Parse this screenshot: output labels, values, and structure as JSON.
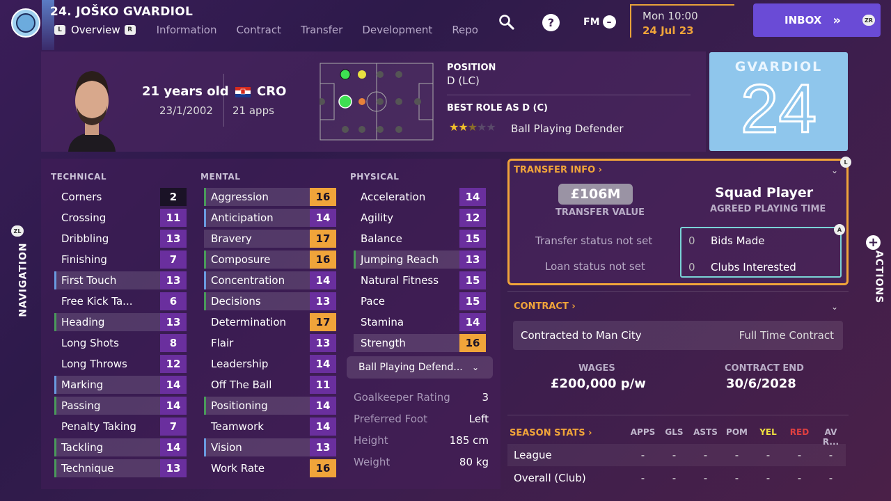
{
  "header": {
    "player_title": "24. JOŠKO GVARDIOL",
    "tabs": [
      "Overview",
      "Information",
      "Contract",
      "Transfer",
      "Development",
      "Repo"
    ],
    "tab_key_left": "L",
    "tab_key_right": "R",
    "fm_label": "FM",
    "date_time": "Mon 10:00",
    "date": "24 Jul 23",
    "inbox_label": "INBOX",
    "inbox_key": "ZR"
  },
  "profile": {
    "age": "21 years old",
    "dob": "23/1/2002",
    "nation": "CRO",
    "apps": "21 apps",
    "position_label": "POSITION",
    "position_value": "D (LC)",
    "best_role_label": "BEST ROLE AS D (C)",
    "best_role_value": "Ball Playing Defender",
    "role_stars": 2.5,
    "shirt_name": "GVARDIOL",
    "shirt_number": "24"
  },
  "attributes": {
    "technical_title": "TECHNICAL",
    "mental_title": "MENTAL",
    "physical_title": "PHYSICAL",
    "technical": [
      {
        "name": "Corners",
        "value": "2"
      },
      {
        "name": "Crossing",
        "value": "11"
      },
      {
        "name": "Dribbling",
        "value": "13"
      },
      {
        "name": "Finishing",
        "value": "7"
      },
      {
        "name": "First Touch",
        "value": "13"
      },
      {
        "name": "Free Kick Ta...",
        "value": "6"
      },
      {
        "name": "Heading",
        "value": "13"
      },
      {
        "name": "Long Shots",
        "value": "8"
      },
      {
        "name": "Long Throws",
        "value": "12"
      },
      {
        "name": "Marking",
        "value": "14"
      },
      {
        "name": "Passing",
        "value": "14"
      },
      {
        "name": "Penalty Taking",
        "value": "7"
      },
      {
        "name": "Tackling",
        "value": "14"
      },
      {
        "name": "Technique",
        "value": "13"
      }
    ],
    "mental": [
      {
        "name": "Aggression",
        "value": "16"
      },
      {
        "name": "Anticipation",
        "value": "14"
      },
      {
        "name": "Bravery",
        "value": "17"
      },
      {
        "name": "Composure",
        "value": "16"
      },
      {
        "name": "Concentration",
        "value": "14"
      },
      {
        "name": "Decisions",
        "value": "13"
      },
      {
        "name": "Determination",
        "value": "17"
      },
      {
        "name": "Flair",
        "value": "13"
      },
      {
        "name": "Leadership",
        "value": "14"
      },
      {
        "name": "Off The Ball",
        "value": "11"
      },
      {
        "name": "Positioning",
        "value": "14"
      },
      {
        "name": "Teamwork",
        "value": "14"
      },
      {
        "name": "Vision",
        "value": "13"
      },
      {
        "name": "Work Rate",
        "value": "16"
      }
    ],
    "physical": [
      {
        "name": "Acceleration",
        "value": "14"
      },
      {
        "name": "Agility",
        "value": "12"
      },
      {
        "name": "Balance",
        "value": "15"
      },
      {
        "name": "Jumping Reach",
        "value": "13"
      },
      {
        "name": "Natural Fitness",
        "value": "15"
      },
      {
        "name": "Pace",
        "value": "15"
      },
      {
        "name": "Stamina",
        "value": "14"
      },
      {
        "name": "Strength",
        "value": "16"
      }
    ],
    "role_select": "Ball Playing Defend...",
    "misc": [
      {
        "k": "Goalkeeper Rating",
        "v": "3"
      },
      {
        "k": "Preferred Foot",
        "v": "Left"
      },
      {
        "k": "Height",
        "v": "185 cm"
      },
      {
        "k": "Weight",
        "v": "80 kg"
      }
    ]
  },
  "side": {
    "navigation": "NAVIGATION",
    "nav_key": "ZL",
    "actions": "ACTIONS",
    "key_l": "L",
    "key_a": "A"
  },
  "transfer": {
    "title": "TRANSFER INFO",
    "value": "£106M",
    "value_label": "TRANSFER VALUE",
    "playing_time": "Squad Player",
    "playing_time_label": "AGREED PLAYING TIME",
    "transfer_status": "Transfer status not set",
    "loan_status": "Loan status not set",
    "bids_count": "0",
    "bids_label": "Bids Made",
    "clubs_count": "0",
    "clubs_label": "Clubs Interested"
  },
  "contract": {
    "title": "CONTRACT",
    "contracted_to": "Contracted to Man City",
    "contract_type": "Full Time Contract",
    "wages_label": "WAGES",
    "wages": "£200,000 p/w",
    "end_label": "CONTRACT END",
    "end": "30/6/2028"
  },
  "season": {
    "title": "SEASON STATS",
    "headers": [
      "APPS",
      "GLS",
      "ASTS",
      "POM",
      "YEL",
      "RED",
      "AV R..."
    ],
    "rows": [
      {
        "label": "League",
        "cells": [
          "-",
          "-",
          "-",
          "-",
          "-",
          "-",
          "-"
        ]
      },
      {
        "label": "Overall (Club)",
        "cells": [
          "-",
          "-",
          "-",
          "-",
          "-",
          "-",
          "-"
        ]
      }
    ]
  },
  "colors": {
    "accent": "#f0a43a",
    "purple_value": "#6a2f9e",
    "orange_value": "#f0a43a",
    "dark_value": "#1a1226",
    "inbox": "#6a4bd6",
    "interest_border": "#7ad3d6"
  }
}
